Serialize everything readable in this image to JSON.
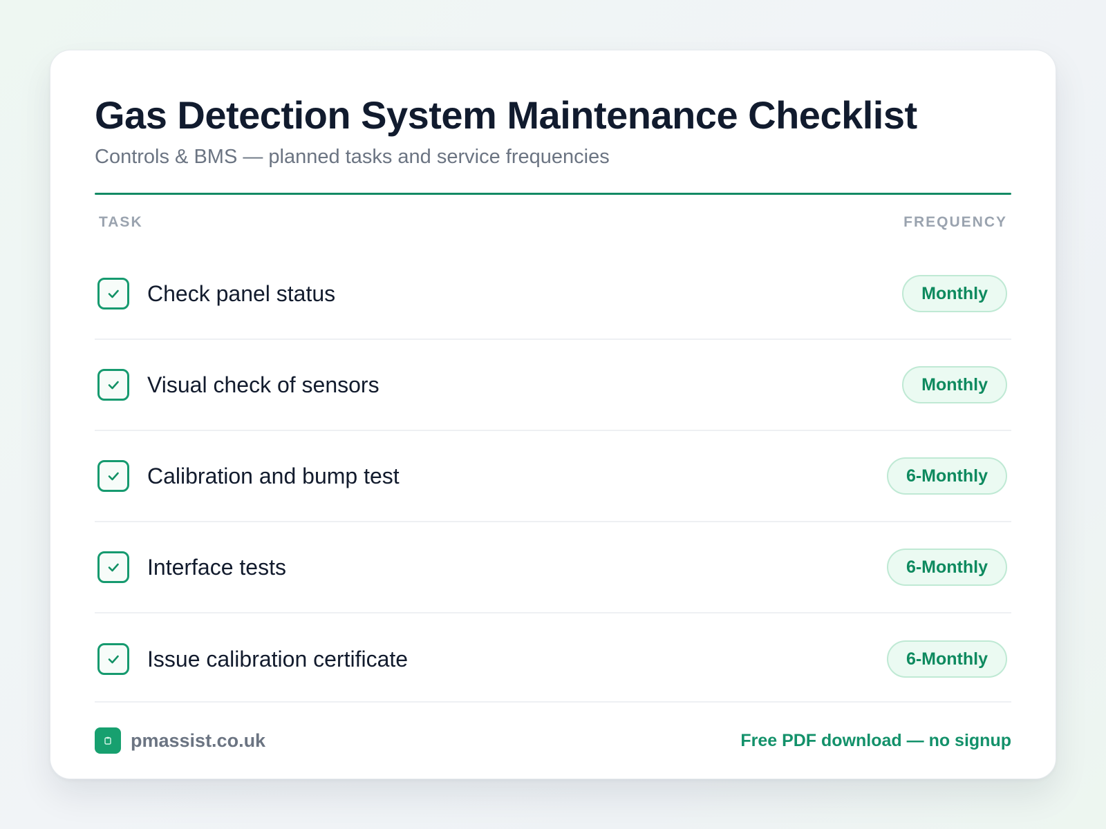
{
  "header": {
    "title": "Gas Detection System Maintenance Checklist",
    "subtitle": "Controls & BMS — planned tasks and service frequencies"
  },
  "table": {
    "columns": {
      "task": "TASK",
      "frequency": "FREQUENCY"
    },
    "rows": [
      {
        "task": "Check panel status",
        "frequency": "Monthly",
        "checked": true
      },
      {
        "task": "Visual check of sensors",
        "frequency": "Monthly",
        "checked": true
      },
      {
        "task": "Calibration and bump test",
        "frequency": "6-Monthly",
        "checked": true
      },
      {
        "task": "Interface tests",
        "frequency": "6-Monthly",
        "checked": true
      },
      {
        "task": "Issue calibration certificate",
        "frequency": "6-Monthly",
        "checked": true
      }
    ]
  },
  "footer": {
    "site": "pmassist.co.uk",
    "cta": "Free PDF download — no signup"
  },
  "colors": {
    "accent": "#138a64",
    "badge_bg": "#ebfaf2",
    "badge_border": "#bfe9d4",
    "title": "#111b2e"
  },
  "icons": {
    "checkbox": "check-icon",
    "logo": "clipboard-icon"
  }
}
